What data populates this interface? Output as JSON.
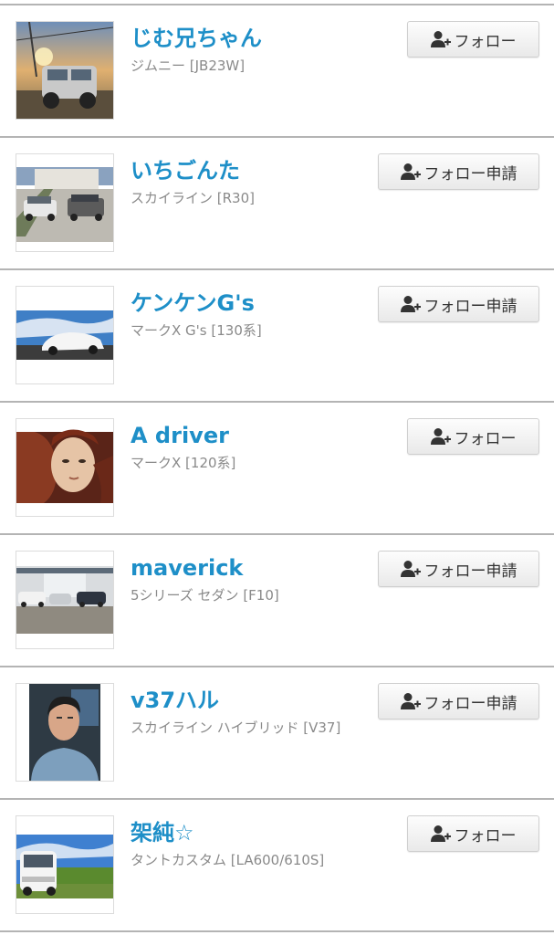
{
  "users": [
    {
      "name": "じむ兄ちゃん",
      "car": "ジムニー [JB23W]",
      "button": "フォロー",
      "button_type": "short",
      "avatar_icon": "jimny-photo"
    },
    {
      "name": "いちごんた",
      "car": "スカイライン [R30]",
      "button": "フォロー申請",
      "button_type": "long",
      "avatar_icon": "garage-cars-photo"
    },
    {
      "name": "ケンケンG's",
      "car": "マークX G's [130系]",
      "button": "フォロー申請",
      "button_type": "long",
      "avatar_icon": "white-sedan-sky-photo"
    },
    {
      "name": "A driver",
      "car": "マークX [120系]",
      "button": "フォロー",
      "button_type": "short",
      "avatar_icon": "painting-portrait"
    },
    {
      "name": "maverick",
      "car": "5シリーズ セダン [F10]",
      "button": "フォロー申請",
      "button_type": "long",
      "avatar_icon": "dealership-photo"
    },
    {
      "name": "v37ハル",
      "car": "スカイライン ハイブリッド [V37]",
      "button": "フォロー申請",
      "button_type": "long",
      "avatar_icon": "person-portrait"
    },
    {
      "name": "架純☆",
      "car": "タントカスタム [LA600/610S]",
      "button": "フォロー",
      "button_type": "short",
      "avatar_icon": "kei-car-field-photo"
    }
  ],
  "colors": {
    "name": "#1e8fc8",
    "subtext": "#8a8a8a",
    "divider": "#b4b4b4"
  }
}
